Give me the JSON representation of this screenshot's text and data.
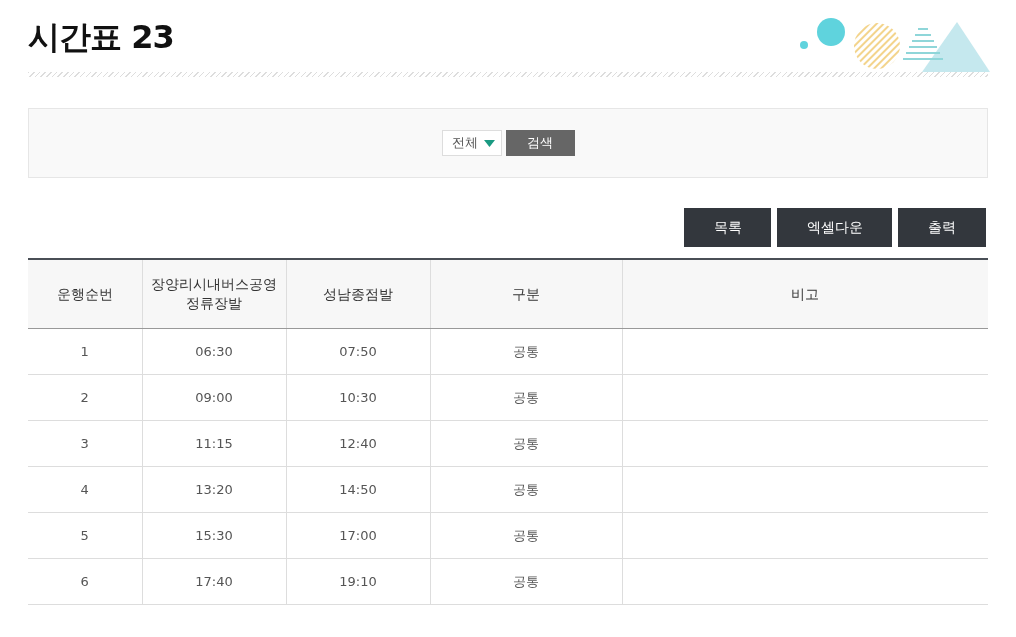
{
  "title": "시간표 23",
  "filter": {
    "select": "전체",
    "search_button": "검색"
  },
  "actions": [
    "목록",
    "엑셀다운",
    "출력"
  ],
  "table": {
    "columns": [
      "운행순번",
      "장양리시내버스공영정류장발",
      "성남종점발",
      "구분",
      "비고"
    ],
    "rows": [
      [
        "1",
        "06:30",
        "07:50",
        "공통"
      ],
      [
        "2",
        "09:00",
        "10:30",
        "공통"
      ],
      [
        "3",
        "11:15",
        "12:40",
        "공통"
      ],
      [
        "4",
        "13:20",
        "14:50",
        "공통"
      ],
      [
        "5",
        "15:30",
        "17:00",
        "공통"
      ],
      [
        "6",
        "17:40",
        "19:10",
        "공통"
      ]
    ]
  }
}
